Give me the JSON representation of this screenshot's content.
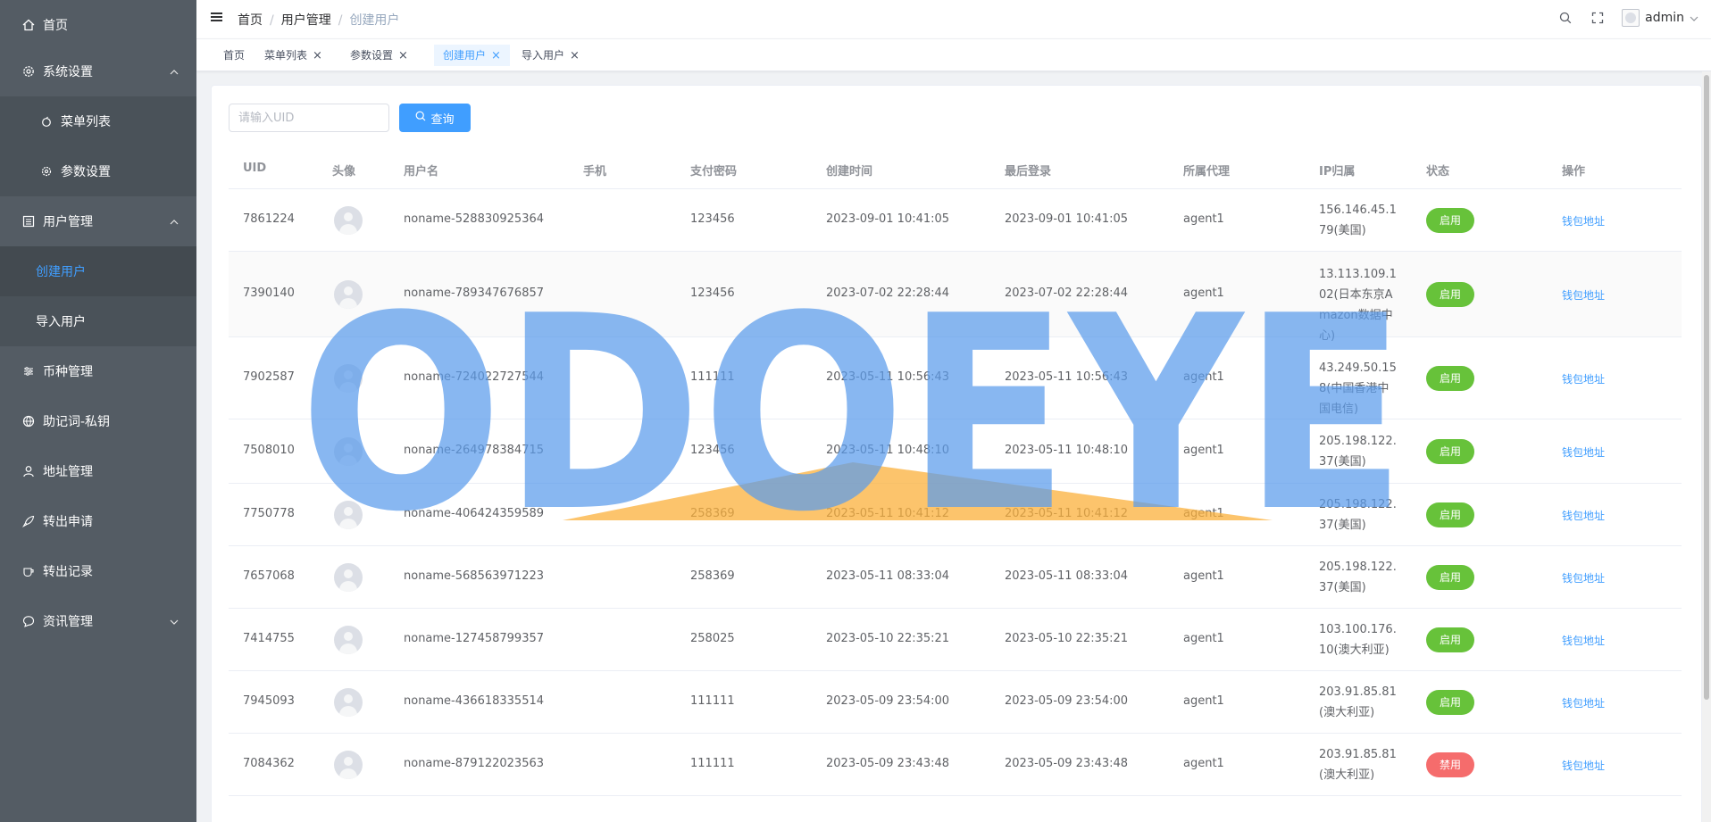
{
  "sidebar": {
    "items": [
      {
        "label": "首页",
        "icon": "home-icon"
      },
      {
        "label": "系统设置",
        "icon": "gear-icon"
      },
      {
        "label": "菜单列表",
        "icon": "apple-icon"
      },
      {
        "label": "参数设置",
        "icon": "gear-icon"
      },
      {
        "label": "用户管理",
        "icon": "list-icon"
      },
      {
        "label": "创建用户"
      },
      {
        "label": "导入用户"
      },
      {
        "label": "币种管理",
        "icon": "sliders-icon"
      },
      {
        "label": "助记词-私钥",
        "icon": "globe-icon"
      },
      {
        "label": "地址管理",
        "icon": "user-icon"
      },
      {
        "label": "转出申请",
        "icon": "rocket-icon"
      },
      {
        "label": "转出记录",
        "icon": "cup-icon"
      },
      {
        "label": "资讯管理",
        "icon": "chat-icon"
      }
    ]
  },
  "header": {
    "breadcrumb": [
      "首页",
      "用户管理",
      "创建用户"
    ],
    "separator": "/",
    "user": "admin"
  },
  "tags": [
    {
      "label": "首页"
    },
    {
      "label": "菜单列表"
    },
    {
      "label": "参数设置"
    },
    {
      "label": "创建用户"
    },
    {
      "label": "导入用户"
    }
  ],
  "search": {
    "placeholder": "请输入UID",
    "button_label": "查询"
  },
  "table": {
    "columns": [
      "UID",
      "头像",
      "用户名",
      "手机",
      "支付密码",
      "创建时间",
      "最后登录",
      "所属代理",
      "IP归属",
      "状态",
      "操作"
    ],
    "rows": [
      {
        "uid": "7861224",
        "username": "noname-528830925364",
        "phone": "",
        "pay_pwd": "123456",
        "created": "2023-09-01 10:41:05",
        "last_login": "2023-09-01 10:41:05",
        "agent": "agent1",
        "ip": "156.146.45.179(美国)",
        "status": "启用",
        "action": "钱包地址"
      },
      {
        "uid": "7390140",
        "username": "noname-789347676857",
        "phone": "",
        "pay_pwd": "123456",
        "created": "2023-07-02 22:28:44",
        "last_login": "2023-07-02 22:28:44",
        "agent": "agent1",
        "ip": "13.113.109.102(日本东京Amazon数据中心)",
        "status": "启用",
        "action": "钱包地址"
      },
      {
        "uid": "7902587",
        "username": "noname-724022727544",
        "phone": "",
        "pay_pwd": "111111",
        "created": "2023-05-11 10:56:43",
        "last_login": "2023-05-11 10:56:43",
        "agent": "agent1",
        "ip": "43.249.50.158(中国香港中国电信)",
        "status": "启用",
        "action": "钱包地址"
      },
      {
        "uid": "7508010",
        "username": "noname-264978384715",
        "phone": "",
        "pay_pwd": "123456",
        "created": "2023-05-11 10:48:10",
        "last_login": "2023-05-11 10:48:10",
        "agent": "agent1",
        "ip": "205.198.122.37(美国)",
        "status": "启用",
        "action": "钱包地址"
      },
      {
        "uid": "7750778",
        "username": "noname-406424359589",
        "phone": "",
        "pay_pwd": "258369",
        "created": "2023-05-11 10:41:12",
        "last_login": "2023-05-11 10:41:12",
        "agent": "agent1",
        "ip": "205.198.122.37(美国)",
        "status": "启用",
        "action": "钱包地址"
      },
      {
        "uid": "7657068",
        "username": "noname-568563971223",
        "phone": "",
        "pay_pwd": "258369",
        "created": "2023-05-11 08:33:04",
        "last_login": "2023-05-11 08:33:04",
        "agent": "agent1",
        "ip": "205.198.122.37(美国)",
        "status": "启用",
        "action": "钱包地址"
      },
      {
        "uid": "7414755",
        "username": "noname-127458799357",
        "phone": "",
        "pay_pwd": "258025",
        "created": "2023-05-10 22:35:21",
        "last_login": "2023-05-10 22:35:21",
        "agent": "agent1",
        "ip": "103.100.176.10(澳大利亚)",
        "status": "启用",
        "action": "钱包地址"
      },
      {
        "uid": "7945093",
        "username": "noname-436618335514",
        "phone": "",
        "pay_pwd": "111111",
        "created": "2023-05-09 23:54:00",
        "last_login": "2023-05-09 23:54:00",
        "agent": "agent1",
        "ip": "203.91.85.81(澳大利亚)",
        "status": "启用",
        "action": "钱包地址"
      },
      {
        "uid": "7084362",
        "username": "noname-879122023563",
        "phone": "",
        "pay_pwd": "111111",
        "created": "2023-05-09 23:43:48",
        "last_login": "2023-05-09 23:43:48",
        "agent": "agent1",
        "ip": "203.91.85.81(澳大利亚)",
        "status": "禁用",
        "action": "钱包地址"
      }
    ]
  },
  "watermark": {
    "text": "ODOEYE"
  },
  "colors": {
    "sidebar_bg": "#545c64",
    "accent": "#409eff",
    "status_on": "#67c23a",
    "status_off": "#f56c6c",
    "watermark_blue": "#5b9cec",
    "watermark_orange": "#fbb03b"
  }
}
